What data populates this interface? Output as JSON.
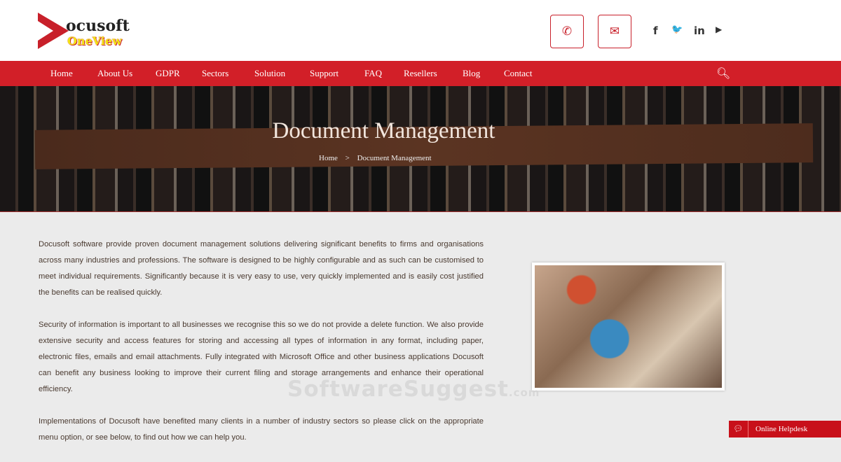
{
  "brand": {
    "line1": "ocusoft",
    "line2": "OneView"
  },
  "header": {
    "phone_icon": "phone-icon",
    "mail_icon": "mail-icon",
    "social": [
      "f",
      "🐦",
      "in",
      "▶"
    ]
  },
  "nav": [
    "Home",
    "About Us",
    "GDPR",
    "Sectors",
    "Solution",
    "Support",
    "FAQ",
    "Resellers",
    "Blog",
    "Contact"
  ],
  "hero": {
    "title": "Document Management",
    "breadcrumb": {
      "home": "Home",
      "sep": ">",
      "current": "Document Management"
    }
  },
  "content": {
    "paragraphs": [
      "Docusoft software provide proven document management solutions delivering significant benefits to firms and organisations across many industries and professions. The software is designed to be highly configurable and as such can be customised to meet individual requirements. Significantly because it is very easy to use, very quickly implemented and is easily cost justified the benefits can be realised quickly.",
      "Security of information is important to all businesses we recognise this so we do not provide a delete function. We also provide extensive security and access features for storing and accessing all types of information in any format, including paper, electronic files, emails and email attachments. Fully integrated with Microsoft Office and other business applications Docusoft can benefit any business looking to improve their current filing and storage arrangements and enhance their operational efficiency.",
      "Implementations of Docusoft have benefited many clients in a number of industry sectors so please click on the appropriate menu option, or see below, to find out how we can help you."
    ]
  },
  "watermark": {
    "main": "SoftwareSuggest",
    "suffix": ".com"
  },
  "helpdesk": {
    "label": "Online Helpdesk"
  }
}
